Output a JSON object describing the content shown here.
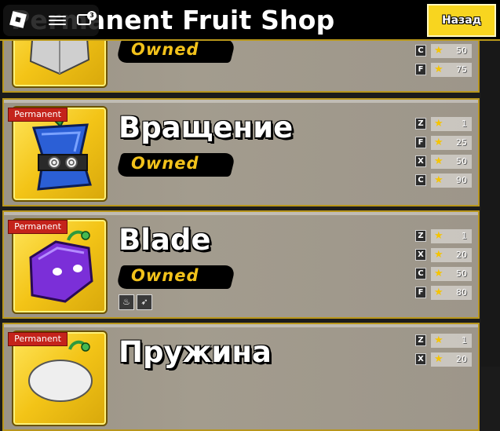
{
  "shop": {
    "title": "Permanent Fruit Shop",
    "back_label": "Назад"
  },
  "roblox_menu": {
    "notification_count": "3",
    "logo_icon": "roblox-logo-icon",
    "menu_icon": "hamburger-icon",
    "chat_icon": "chat-icon"
  },
  "items": [
    {
      "name": "",
      "badge": "",
      "status": "Owned",
      "color": "#cfcfcf",
      "moves": [
        {
          "key": "C",
          "level": "50"
        },
        {
          "key": "F",
          "level": "75"
        }
      ]
    },
    {
      "name": "Вращение",
      "badge": "Permanent",
      "status": "Owned",
      "color": "#2b5fd6",
      "moves": [
        {
          "key": "Z",
          "level": "1"
        },
        {
          "key": "F",
          "level": "25"
        },
        {
          "key": "X",
          "level": "50"
        },
        {
          "key": "C",
          "level": "90"
        }
      ]
    },
    {
      "name": "Blade",
      "badge": "Permanent",
      "status": "Owned",
      "color": "#7b2fd8",
      "ability_icons": [
        "flame-icon",
        "feather-icon"
      ],
      "moves": [
        {
          "key": "Z",
          "level": "1"
        },
        {
          "key": "X",
          "level": "20"
        },
        {
          "key": "C",
          "level": "50"
        },
        {
          "key": "F",
          "level": "80"
        }
      ]
    },
    {
      "name": "Пружина",
      "badge": "Permanent",
      "status": "",
      "color": "#e8e8e8",
      "moves": [
        {
          "key": "Z",
          "level": "1"
        },
        {
          "key": "X",
          "level": "20"
        }
      ]
    }
  ]
}
